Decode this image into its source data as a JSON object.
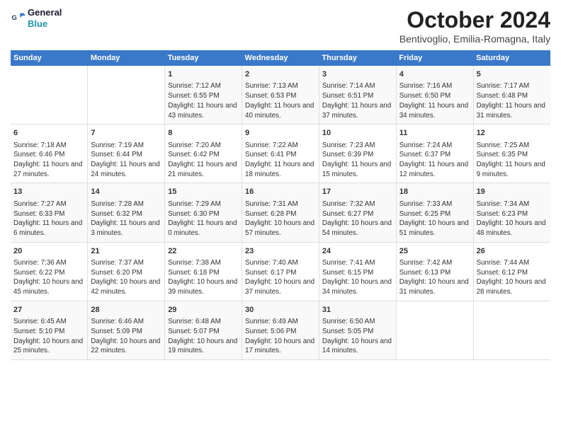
{
  "logo": {
    "line1": "General",
    "line2": "Blue"
  },
  "title": "October 2024",
  "subtitle": "Bentivoglio, Emilia-Romagna, Italy",
  "headers": [
    "Sunday",
    "Monday",
    "Tuesday",
    "Wednesday",
    "Thursday",
    "Friday",
    "Saturday"
  ],
  "weeks": [
    [
      {
        "day": "",
        "info": ""
      },
      {
        "day": "",
        "info": ""
      },
      {
        "day": "1",
        "info": "Sunrise: 7:12 AM\nSunset: 6:55 PM\nDaylight: 11 hours and 43 minutes."
      },
      {
        "day": "2",
        "info": "Sunrise: 7:13 AM\nSunset: 6:53 PM\nDaylight: 11 hours and 40 minutes."
      },
      {
        "day": "3",
        "info": "Sunrise: 7:14 AM\nSunset: 6:51 PM\nDaylight: 11 hours and 37 minutes."
      },
      {
        "day": "4",
        "info": "Sunrise: 7:16 AM\nSunset: 6:50 PM\nDaylight: 11 hours and 34 minutes."
      },
      {
        "day": "5",
        "info": "Sunrise: 7:17 AM\nSunset: 6:48 PM\nDaylight: 11 hours and 31 minutes."
      }
    ],
    [
      {
        "day": "6",
        "info": "Sunrise: 7:18 AM\nSunset: 6:46 PM\nDaylight: 11 hours and 27 minutes."
      },
      {
        "day": "7",
        "info": "Sunrise: 7:19 AM\nSunset: 6:44 PM\nDaylight: 11 hours and 24 minutes."
      },
      {
        "day": "8",
        "info": "Sunrise: 7:20 AM\nSunset: 6:42 PM\nDaylight: 11 hours and 21 minutes."
      },
      {
        "day": "9",
        "info": "Sunrise: 7:22 AM\nSunset: 6:41 PM\nDaylight: 11 hours and 18 minutes."
      },
      {
        "day": "10",
        "info": "Sunrise: 7:23 AM\nSunset: 6:39 PM\nDaylight: 11 hours and 15 minutes."
      },
      {
        "day": "11",
        "info": "Sunrise: 7:24 AM\nSunset: 6:37 PM\nDaylight: 11 hours and 12 minutes."
      },
      {
        "day": "12",
        "info": "Sunrise: 7:25 AM\nSunset: 6:35 PM\nDaylight: 11 hours and 9 minutes."
      }
    ],
    [
      {
        "day": "13",
        "info": "Sunrise: 7:27 AM\nSunset: 6:33 PM\nDaylight: 11 hours and 6 minutes."
      },
      {
        "day": "14",
        "info": "Sunrise: 7:28 AM\nSunset: 6:32 PM\nDaylight: 11 hours and 3 minutes."
      },
      {
        "day": "15",
        "info": "Sunrise: 7:29 AM\nSunset: 6:30 PM\nDaylight: 11 hours and 0 minutes."
      },
      {
        "day": "16",
        "info": "Sunrise: 7:31 AM\nSunset: 6:28 PM\nDaylight: 10 hours and 57 minutes."
      },
      {
        "day": "17",
        "info": "Sunrise: 7:32 AM\nSunset: 6:27 PM\nDaylight: 10 hours and 54 minutes."
      },
      {
        "day": "18",
        "info": "Sunrise: 7:33 AM\nSunset: 6:25 PM\nDaylight: 10 hours and 51 minutes."
      },
      {
        "day": "19",
        "info": "Sunrise: 7:34 AM\nSunset: 6:23 PM\nDaylight: 10 hours and 48 minutes."
      }
    ],
    [
      {
        "day": "20",
        "info": "Sunrise: 7:36 AM\nSunset: 6:22 PM\nDaylight: 10 hours and 45 minutes."
      },
      {
        "day": "21",
        "info": "Sunrise: 7:37 AM\nSunset: 6:20 PM\nDaylight: 10 hours and 42 minutes."
      },
      {
        "day": "22",
        "info": "Sunrise: 7:38 AM\nSunset: 6:18 PM\nDaylight: 10 hours and 39 minutes."
      },
      {
        "day": "23",
        "info": "Sunrise: 7:40 AM\nSunset: 6:17 PM\nDaylight: 10 hours and 37 minutes."
      },
      {
        "day": "24",
        "info": "Sunrise: 7:41 AM\nSunset: 6:15 PM\nDaylight: 10 hours and 34 minutes."
      },
      {
        "day": "25",
        "info": "Sunrise: 7:42 AM\nSunset: 6:13 PM\nDaylight: 10 hours and 31 minutes."
      },
      {
        "day": "26",
        "info": "Sunrise: 7:44 AM\nSunset: 6:12 PM\nDaylight: 10 hours and 28 minutes."
      }
    ],
    [
      {
        "day": "27",
        "info": "Sunrise: 6:45 AM\nSunset: 5:10 PM\nDaylight: 10 hours and 25 minutes."
      },
      {
        "day": "28",
        "info": "Sunrise: 6:46 AM\nSunset: 5:09 PM\nDaylight: 10 hours and 22 minutes."
      },
      {
        "day": "29",
        "info": "Sunrise: 6:48 AM\nSunset: 5:07 PM\nDaylight: 10 hours and 19 minutes."
      },
      {
        "day": "30",
        "info": "Sunrise: 6:49 AM\nSunset: 5:06 PM\nDaylight: 10 hours and 17 minutes."
      },
      {
        "day": "31",
        "info": "Sunrise: 6:50 AM\nSunset: 5:05 PM\nDaylight: 10 hours and 14 minutes."
      },
      {
        "day": "",
        "info": ""
      },
      {
        "day": "",
        "info": ""
      }
    ]
  ]
}
